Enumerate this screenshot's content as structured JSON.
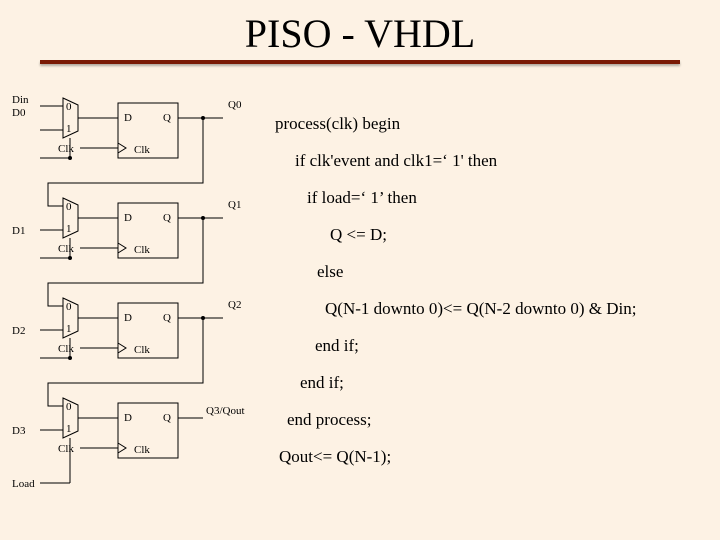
{
  "title": "PISO - VHDL",
  "code": {
    "l1": "process(clk) begin",
    "l2": "if clk'event and clk1=‘ 1' then",
    "l3": "if load=‘ 1’ then",
    "l4": "Q <= D;",
    "l5": "else",
    "l6": "Q(N-1 downto 0)<= Q(N-2 downto 0) & Din;",
    "l7": "end if;",
    "l8": "end if;",
    "l9": "end process;",
    "l10": "Qout<= Q(N-1);"
  },
  "diagram": {
    "Din": "Din",
    "D0": "D0",
    "D1": "D1",
    "D2": "D2",
    "D3": "D3",
    "Clk": "Clk",
    "Load": "Load",
    "D": "D",
    "Q": "Q",
    "Q0": "Q0",
    "Q1": "Q1",
    "Q2": "Q2",
    "Q3Qout": "Q3/Qout",
    "mux0": "0",
    "mux1": "1"
  }
}
